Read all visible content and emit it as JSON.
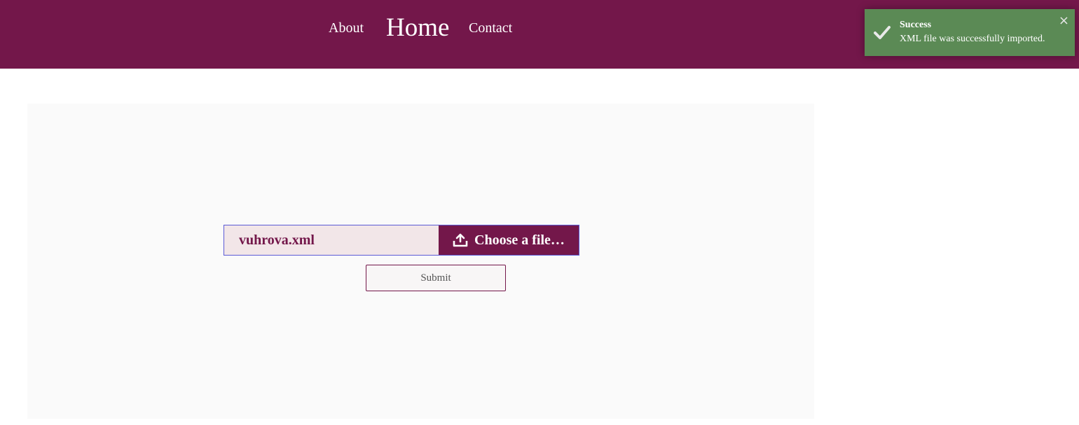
{
  "nav": {
    "about_label": "About",
    "home_label": "Home",
    "contact_label": "Contact"
  },
  "toast": {
    "title": "Success",
    "message": "XML file was successfully imported.",
    "close_label": "×",
    "icon": "check-icon"
  },
  "upload": {
    "file_name": "vuhrova.xml",
    "choose_label": "Choose a file…",
    "choose_icon": "upload-icon",
    "submit_label": "Submit"
  },
  "colors": {
    "brand": "#73174a",
    "success": "#5b8a55",
    "file_field_bg": "#f2e6e8",
    "panel_bg": "#fafafa"
  }
}
